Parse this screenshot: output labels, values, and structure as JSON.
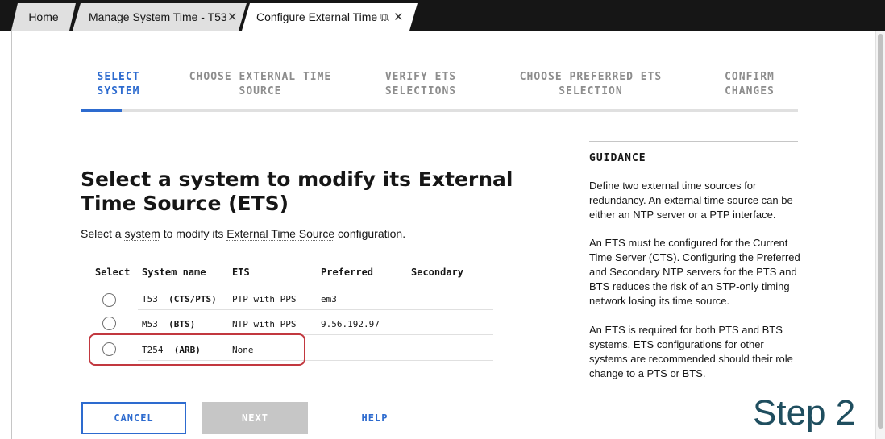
{
  "tabs": {
    "home": "Home",
    "manage": "Manage System Time - T53",
    "configure": "Configure External Time ...",
    "close_glyph": "✕",
    "popout_glyph": "⧉"
  },
  "stepper": {
    "steps": [
      {
        "line1": "SELECT",
        "line2": "SYSTEM"
      },
      {
        "line1": "CHOOSE EXTERNAL TIME",
        "line2": "SOURCE"
      },
      {
        "line1": "VERIFY ETS",
        "line2": "SELECTIONS"
      },
      {
        "line1": "CHOOSE PREFERRED ETS",
        "line2": "SELECTION"
      },
      {
        "line1": "CONFIRM",
        "line2": "CHANGES"
      }
    ],
    "active_index": 0
  },
  "main": {
    "title": "Select a system to modify its External Time Source (ETS)",
    "subtitle_prefix": "Select a ",
    "subtitle_term1": "system",
    "subtitle_middle": " to modify its ",
    "subtitle_term2": "External Time Source",
    "subtitle_suffix": " configuration."
  },
  "table": {
    "headers": [
      "Select",
      "System name",
      "ETS",
      "Preferred",
      "Secondary"
    ],
    "rows": [
      {
        "name": "T53",
        "role": "(CTS/PTS)",
        "ets": "PTP with PPS",
        "preferred": "em3",
        "secondary": ""
      },
      {
        "name": "M53",
        "role": "(BTS)",
        "ets": "NTP with PPS",
        "preferred": "9.56.192.97",
        "secondary": ""
      },
      {
        "name": "T254",
        "role": "(ARB)",
        "ets": "None",
        "preferred": "",
        "secondary": ""
      }
    ]
  },
  "guidance": {
    "title": "GUIDANCE",
    "paragraphs": [
      "Define two external time sources for redundancy. An external time source can be either an NTP server or a PTP interface.",
      "An ETS must be configured for the Current Time Server (CTS). Configuring the Preferred and Secondary NTP servers for the PTS and BTS reduces the risk of an STP-only timing network losing its time source.",
      "An ETS is required for both PTS and BTS systems. ETS configurations for other systems are recommended should their role change to a PTS or BTS."
    ]
  },
  "buttons": {
    "cancel": "CANCEL",
    "next": "NEXT",
    "help": "HELP"
  },
  "annotation": "Step 2",
  "colors": {
    "accent": "#2d6bcf",
    "highlight": "#c2383f",
    "annotation": "#1f4e5f"
  }
}
